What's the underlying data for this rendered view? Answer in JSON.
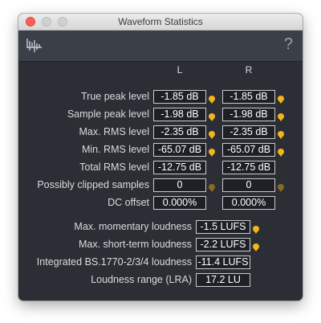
{
  "window": {
    "title": "Waveform Statistics"
  },
  "toolbar": {
    "help_glyph": "?",
    "left_icon": "waveform-icon"
  },
  "columns": {
    "left": "L",
    "right": "R"
  },
  "rows": [
    {
      "label": "True peak level",
      "l": "-1.85 dB",
      "r": "-1.85 dB",
      "pin": "bright"
    },
    {
      "label": "Sample peak level",
      "l": "-1.98 dB",
      "r": "-1.98 dB",
      "pin": "bright"
    },
    {
      "label": "Max. RMS level",
      "l": "-2.35 dB",
      "r": "-2.35 dB",
      "pin": "bright"
    },
    {
      "label": "Min. RMS level",
      "l": "-65.07 dB",
      "r": "-65.07 dB",
      "pin": "bright"
    },
    {
      "label": "Total RMS level",
      "l": "-12.75 dB",
      "r": "-12.75 dB",
      "pin": "none"
    },
    {
      "label": "Possibly clipped samples",
      "l": "0",
      "r": "0",
      "pin": "dim"
    },
    {
      "label": "DC offset",
      "l": "0.000%",
      "r": "0.000%",
      "pin": "none"
    }
  ],
  "loudness": [
    {
      "label": "Max. momentary loudness",
      "value": "-1.5 LUFS",
      "pin": "bright"
    },
    {
      "label": "Max. short-term loudness",
      "value": "-2.2 LUFS",
      "pin": "bright"
    },
    {
      "label": "Integrated BS.1770-2/3/4 loudness",
      "value": "-11.4 LUFS",
      "pin": "none"
    },
    {
      "label": "Loudness range (LRA)",
      "value": "17.2 LU",
      "pin": "none"
    }
  ],
  "colors": {
    "pin_bright": "#f2b51c",
    "pin_dim": "#8a6a22",
    "panel": "#2b2e34",
    "toolbar": "#3b3f47"
  }
}
